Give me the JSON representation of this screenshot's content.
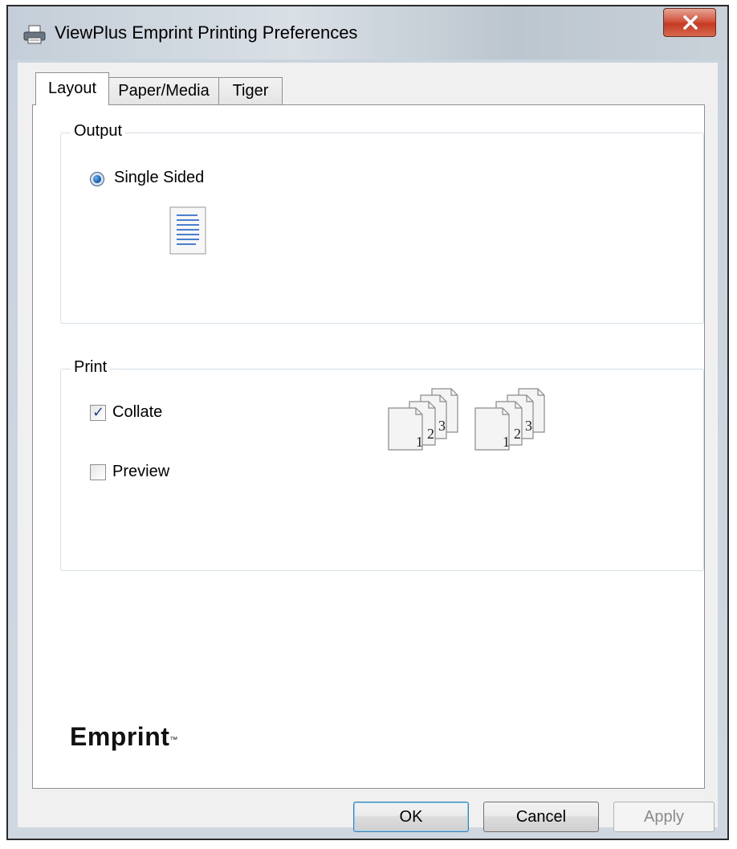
{
  "window": {
    "title": "ViewPlus Emprint Printing Preferences"
  },
  "tabs": [
    {
      "label": "Layout",
      "active": true
    },
    {
      "label": "Paper/Media",
      "active": false
    },
    {
      "label": "Tiger",
      "active": false
    }
  ],
  "output": {
    "group_label": "Output",
    "single_sided": {
      "label": "Single Sided",
      "selected": true
    }
  },
  "print": {
    "group_label": "Print",
    "collate": {
      "label": "Collate",
      "checked": true
    },
    "preview": {
      "label": "Preview",
      "checked": false
    },
    "collate_stack_numbers": [
      "1",
      "2",
      "3"
    ]
  },
  "branding": {
    "logo_text": "Emprint"
  },
  "buttons": {
    "ok": "OK",
    "cancel": "Cancel",
    "apply": "Apply"
  }
}
